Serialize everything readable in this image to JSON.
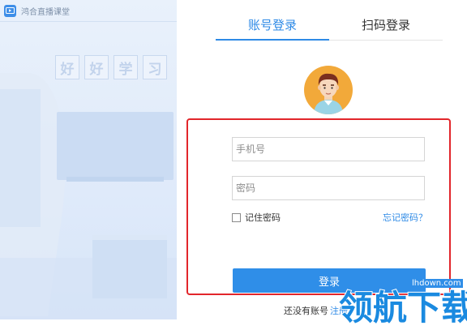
{
  "app": {
    "title": "鸿合直播课堂",
    "slogan": [
      "好",
      "好",
      "学",
      "习"
    ]
  },
  "tabs": [
    {
      "label": "账号登录",
      "active": true
    },
    {
      "label": "扫码登录",
      "active": false
    }
  ],
  "form": {
    "phone_placeholder": "手机号",
    "password_placeholder": "密码",
    "remember_label": "记住密码",
    "remember_checked": false,
    "forgot_label": "忘记密码？",
    "login_label": "登录"
  },
  "footer": {
    "no_account_text": "还没有账号",
    "register_label": "注册"
  },
  "watermark": {
    "url": "lhdown.com",
    "text": "领航下载"
  },
  "colors": {
    "accent": "#2e8ae6",
    "highlight": "#e2262b",
    "avatar_bg": "#f2a93a"
  }
}
